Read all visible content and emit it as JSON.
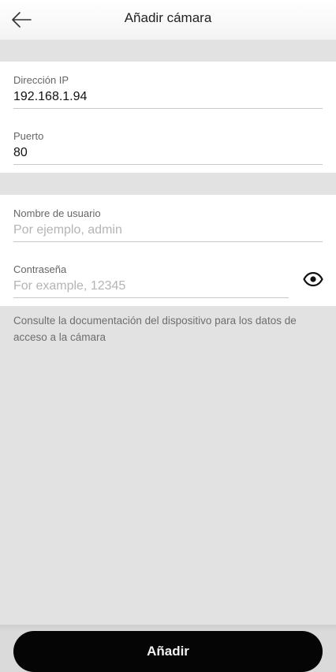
{
  "app_bar": {
    "title": "Añadir cámara",
    "back_icon": "arrow-left-icon"
  },
  "connection": {
    "ip": {
      "label": "Dirección IP",
      "value": "192.168.1.94"
    },
    "port": {
      "label": "Puerto",
      "value": "80"
    }
  },
  "credentials": {
    "username": {
      "label": "Nombre de usuario",
      "value": "",
      "placeholder": "Por ejemplo, admin"
    },
    "password": {
      "label": "Contraseña",
      "value": "",
      "placeholder": "For example, 12345",
      "visibility_icon": "eye-icon"
    }
  },
  "help_text": "Consulte la documentación del dispositivo para los datos de acceso a la cámara",
  "footer": {
    "add_label": "Añadir"
  },
  "colors": {
    "background": "#e2e2e2",
    "card": "#ffffff",
    "primary_button": "#050505",
    "primary_button_text": "#f2f2f2"
  }
}
